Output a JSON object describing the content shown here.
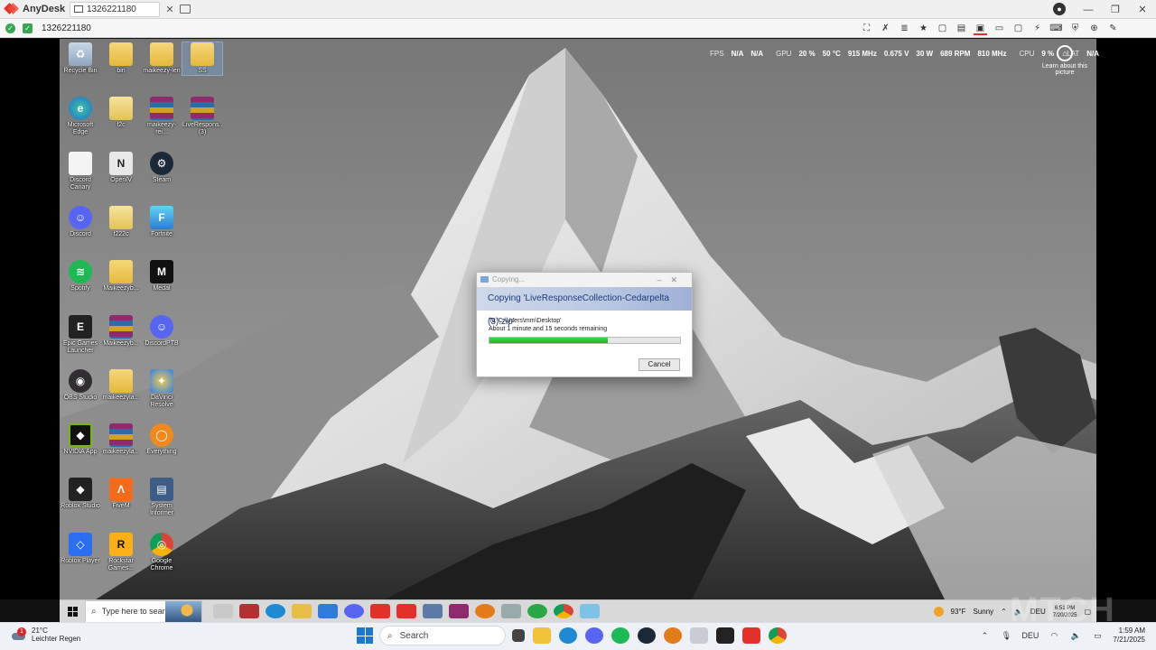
{
  "anydesk": {
    "app_name": "AnyDesk",
    "tab_label": "1326221180",
    "address": "1326221180",
    "win_min": "—",
    "win_max": "❐",
    "win_close": "✕",
    "account_glyph": "●"
  },
  "overlay": {
    "fps_label": "FPS",
    "fps_value": "N/A",
    "fps_value2": "N/A",
    "gpu_label": "GPU",
    "gpu_usage": "20 %",
    "gpu_temp": "50 °C",
    "gpu_clock": "915 MHz",
    "gpu_volt": "0.675 V",
    "gpu_power": "30 W",
    "gpu_fan": "689 RPM",
    "gpu_mem": "810 MHz",
    "cpu_label": "CPU",
    "cpu_value": "9 %",
    "lat_label": "LAT",
    "lat_value": "N/A",
    "learn_more": "Learn about this picture"
  },
  "desktop_icons": [
    {
      "label": "Recycle Bin",
      "kind": "recycle"
    },
    {
      "label": "bin",
      "kind": "folder"
    },
    {
      "label": "maikeezy-len",
      "kind": "folder"
    },
    {
      "label": "SS",
      "kind": "folder"
    },
    {
      "label": "Microsoft Edge",
      "kind": "edge"
    },
    {
      "label": "f2c",
      "kind": "file"
    },
    {
      "label": "maikeezy-rei...",
      "kind": "rar"
    },
    {
      "label": "LiveRespons... (3)",
      "kind": "rar"
    },
    {
      "label": "Discord Canary",
      "kind": "doc"
    },
    {
      "label": "OpenIV",
      "kind": "openiv"
    },
    {
      "label": "Steam",
      "kind": "steam"
    },
    {
      "label": "Discord",
      "kind": "discord"
    },
    {
      "label": "f222c",
      "kind": "file"
    },
    {
      "label": "Fortnite",
      "kind": "fortnite"
    },
    {
      "label": "Spotify",
      "kind": "spotify"
    },
    {
      "label": "Maikeezyb...",
      "kind": "folder"
    },
    {
      "label": "Medal",
      "kind": "medal"
    },
    {
      "label": "Epic Games Launcher",
      "kind": "epic"
    },
    {
      "label": "Maikeezyb...",
      "kind": "rar"
    },
    {
      "label": "DiscordPTB",
      "kind": "discord"
    },
    {
      "label": "OBS Studio",
      "kind": "obs"
    },
    {
      "label": "maikeezyla...",
      "kind": "folder"
    },
    {
      "label": "DaVinci Resolve",
      "kind": "davinci"
    },
    {
      "label": "NVIDIA App",
      "kind": "nvidia"
    },
    {
      "label": "maikeezyla...",
      "kind": "rar"
    },
    {
      "label": "Everything",
      "kind": "everything"
    },
    {
      "label": "Roblox Studio",
      "kind": "roblox"
    },
    {
      "label": "FiveM",
      "kind": "fivem"
    },
    {
      "label": "System Informer",
      "kind": "sysinf"
    },
    {
      "label": "Roblox Player",
      "kind": "robloxp"
    },
    {
      "label": "Rockstar Games...",
      "kind": "rockstar"
    },
    {
      "label": "Google Chrome",
      "kind": "chrome"
    }
  ],
  "dialog": {
    "title": "Copying...",
    "heading": "Copying 'LiveResponseCollection-Cedarpelta (3).zip'",
    "to_line": "To 'C:\\Users\\mm\\Desktop'",
    "remaining": "About 1 minute and 15 seconds remaining",
    "progress": 0.62,
    "cancel": "Cancel"
  },
  "remote_taskbar": {
    "search_placeholder": "Type here to search",
    "temp": "93°F",
    "weather": "Sunny",
    "lang": "DEU",
    "time": "6:51 PM",
    "date": "7/20/2025"
  },
  "watermark": "MTCH",
  "local_taskbar": {
    "weather_temp": "21°C",
    "weather_desc": "Leichter Regen",
    "weather_badge": "1",
    "search": "Search",
    "lang": "DEU",
    "time": "1:59 AM",
    "date": "7/21/2025"
  },
  "colors": {
    "anydesk_red": "#e2302b",
    "progress_green": "#1eb52c",
    "connected_green": "#3aa655"
  }
}
